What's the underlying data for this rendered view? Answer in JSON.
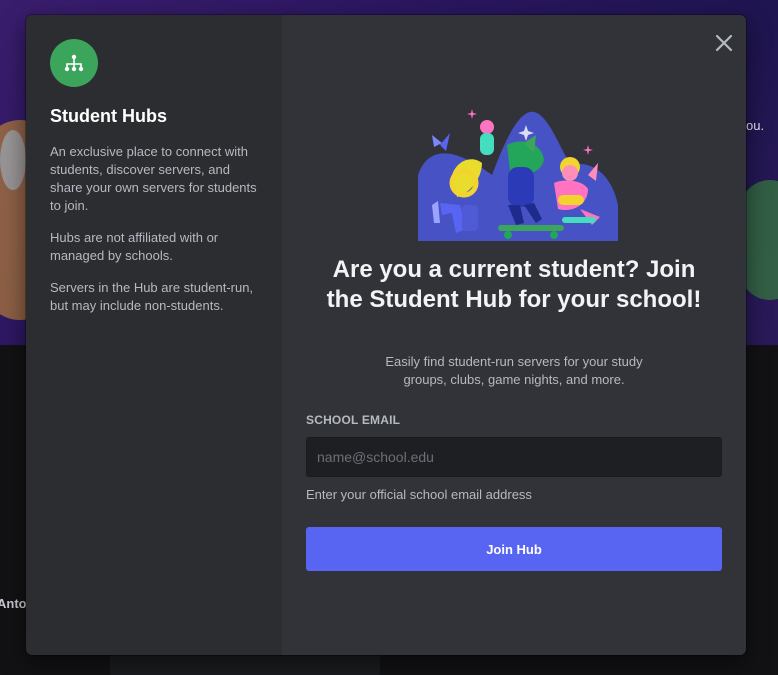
{
  "background": {
    "partial_text_right": "ou.",
    "partial_text_left": "Anto"
  },
  "sidebar": {
    "icon": "hub-network-icon",
    "title": "Student Hubs",
    "paragraphs": [
      "An exclusive place to connect with students, discover servers, and share your own servers for students to join.",
      "Hubs are not affiliated with or managed by schools.",
      "Servers in the Hub are student-run, but may include non-students."
    ]
  },
  "main": {
    "close_icon": "close-icon",
    "headline": "Are you a current student? Join the Student Hub for your school!",
    "subtext": "Easily find student-run servers for your study groups, clubs, game nights, and more.",
    "email": {
      "label": "SCHOOL EMAIL",
      "placeholder": "name@school.edu",
      "value": "",
      "helper": "Enter your official school email address"
    },
    "join_button": "Join Hub"
  },
  "colors": {
    "accent": "#5865f2",
    "hub_icon_bg": "#3ba55c",
    "sidebar_bg": "#2b2d31",
    "main_bg": "#313338"
  }
}
